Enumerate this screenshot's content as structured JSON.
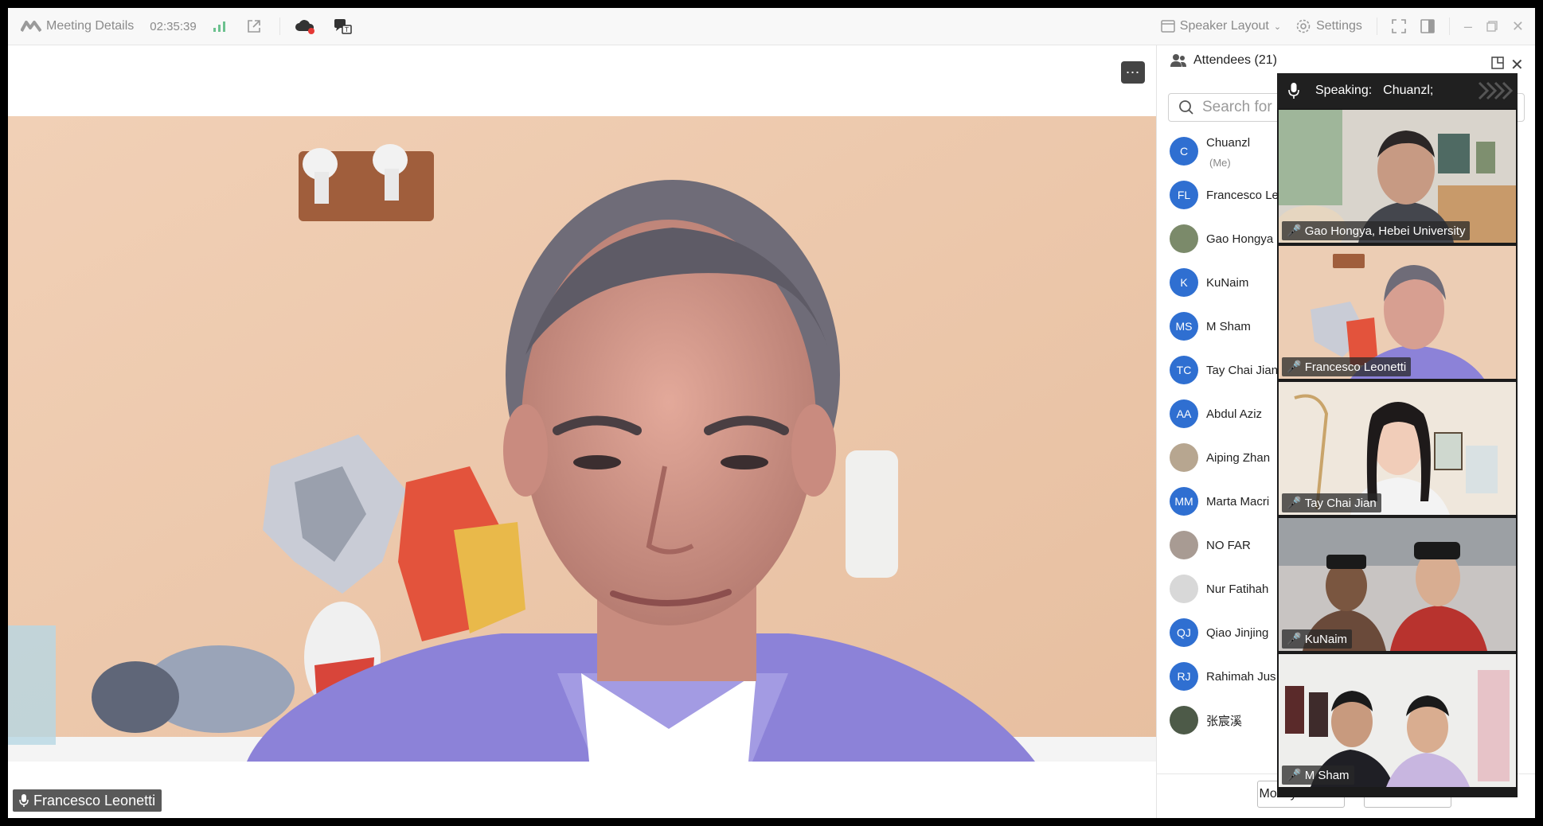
{
  "titlebar": {
    "meeting_details": "Meeting Details",
    "timer": "02:35:39",
    "speaker_layout": "Speaker Layout",
    "settings": "Settings"
  },
  "stage": {
    "speaker_name": "Francesco Leonetti"
  },
  "attendees": {
    "title": "Attendees (21)",
    "search_placeholder": "Search for",
    "items": [
      {
        "initials": "C",
        "name": "Chuanzl",
        "note": "(Me)",
        "color": "#2f6fd1"
      },
      {
        "initials": "FL",
        "name": "Francesco Le",
        "note": "",
        "color": "#2f6fd1"
      },
      {
        "initials": "",
        "name": "Gao Hongya",
        "note": "",
        "color": "#7b8a6a"
      },
      {
        "initials": "K",
        "name": "KuNaim",
        "note": "",
        "color": "#2f6fd1"
      },
      {
        "initials": "MS",
        "name": "M Sham",
        "note": "",
        "color": "#2f6fd1"
      },
      {
        "initials": "TC",
        "name": "Tay Chai Jian",
        "note": "",
        "color": "#2f6fd1"
      },
      {
        "initials": "AA",
        "name": "Abdul Aziz",
        "note": "",
        "color": "#2f6fd1"
      },
      {
        "initials": "",
        "name": "Aiping Zhan",
        "note": "",
        "color": "#b7a690"
      },
      {
        "initials": "MM",
        "name": "Marta Macri",
        "note": "",
        "color": "#2f6fd1"
      },
      {
        "initials": "",
        "name": "NO FAR",
        "note": "",
        "color": "#a89b93"
      },
      {
        "initials": "",
        "name": "Nur Fatihah",
        "note": "",
        "color": "#d8d8d8"
      },
      {
        "initials": "QJ",
        "name": "Qiao Jinjing",
        "note": "",
        "color": "#2f6fd1"
      },
      {
        "initials": "RJ",
        "name": "Rahimah Jus",
        "note": "",
        "color": "#2f6fd1"
      },
      {
        "initials": "",
        "name": "张宸溪",
        "note": "",
        "color": "#4d5a48"
      }
    ],
    "modify_button": "Modify Nickn...",
    "mute_button": "Mute"
  },
  "gallery": {
    "speaking_label": "Speaking:",
    "speaking_name": "Chuanzl;",
    "tiles": [
      {
        "name": "Gao Hongya, Hebei University",
        "muted": false
      },
      {
        "name": "Francesco Leonetti",
        "muted": false
      },
      {
        "name": "Tay Chai Jian",
        "muted": true
      },
      {
        "name": "KuNaim",
        "muted": true
      },
      {
        "name": "M Sham",
        "muted": true
      }
    ]
  }
}
